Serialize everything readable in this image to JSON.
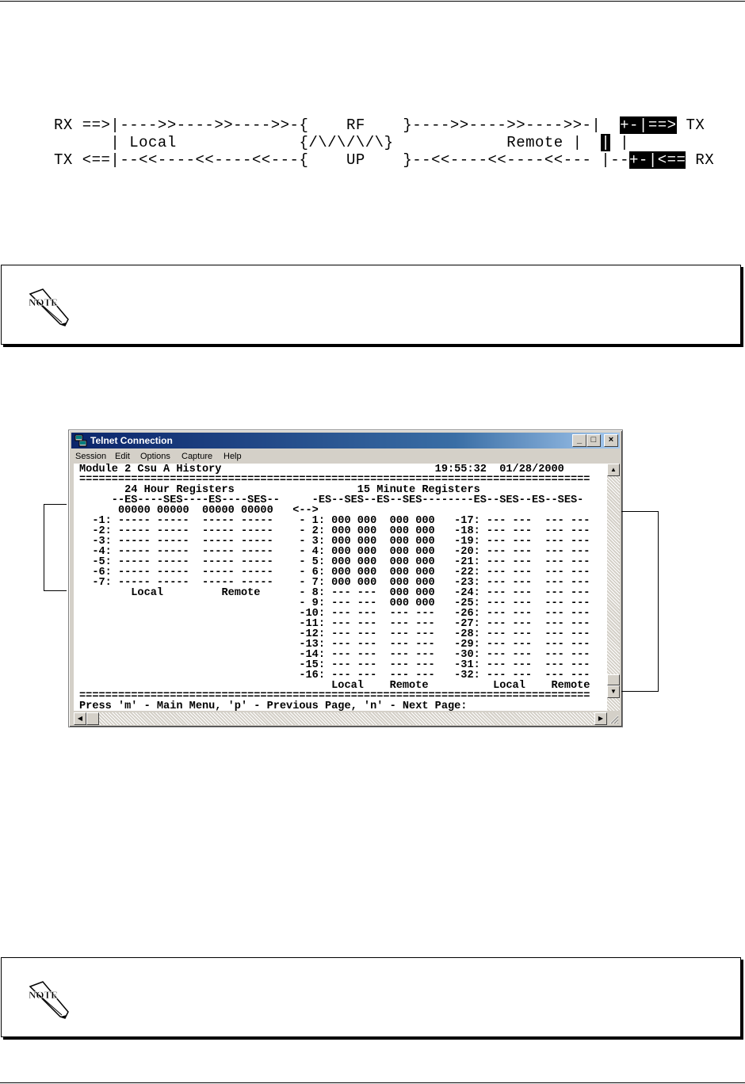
{
  "diagram": {
    "line1_prefix": "RX ==>|---->>---->>---->>-{    RF    }---->>---->>---->>-|  ",
    "line1_box": "+-|==>",
    "line1_suffix": " TX",
    "line2_prefix": "      | Local             {/\\/\\/\\/\\}            Remote |  ",
    "line2_box": "|",
    "line2_mid": " |",
    "line3_prefix": "TX <==|--<<----<<----<<---{    UP    }--<<----<<----<<--- |--",
    "line3_box": "+-|<==",
    "line3_suffix": " RX"
  },
  "telnet": {
    "title": "Telnet Connection",
    "min_btn": "_",
    "max_btn": "□",
    "close_btn": "×",
    "menu": [
      "Session",
      "Edit",
      "Options",
      "Capture",
      "Help"
    ],
    "lines": [
      "Module 2 Csu A History                                 19:55:32  01/28/2000",
      "===============================================================================",
      "       24 Hour Registers                   15 Minute Registers",
      "     --ES----SES----ES----SES--     -ES--SES--ES--SES--------ES--SES--ES--SES-",
      "      00000 00000  00000 00000   <-->",
      "  -1: ----- -----  ----- -----    - 1: 000 000  000 000   -17: --- ---  --- ---",
      "  -2: ----- -----  ----- -----    - 2: 000 000  000 000   -18: --- ---  --- ---",
      "  -3: ----- -----  ----- -----    - 3: 000 000  000 000   -19: --- ---  --- ---",
      "  -4: ----- -----  ----- -----    - 4: 000 000  000 000   -20: --- ---  --- ---",
      "  -5: ----- -----  ----- -----    - 5: 000 000  000 000   -21: --- ---  --- ---",
      "  -6: ----- -----  ----- -----    - 6: 000 000  000 000   -22: --- ---  --- ---",
      "  -7: ----- -----  ----- -----    - 7: 000 000  000 000   -23: --- ---  --- ---",
      "        Local         Remote      - 8: --- ---  000 000   -24: --- ---  --- ---",
      "                                  - 9: --- ---  000 000   -25: --- ---  --- ---",
      "                                  -10: --- ---  --- ---   -26: --- ---  --- ---",
      "                                  -11: --- ---  --- ---   -27: --- ---  --- ---",
      "                                  -12: --- ---  --- ---   -28: --- ---  --- ---",
      "                                  -13: --- ---  --- ---   -29: --- ---  --- ---",
      "                                  -14: --- ---  --- ---   -30: --- ---  --- ---",
      "                                  -15: --- ---  --- ---   -31: --- ---  --- ---",
      "                                  -16: --- ---  --- ---   -32: --- ---  --- ---",
      "                                       Local    Remote          Local    Remote",
      "===============================================================================",
      "Press 'm' - Main Menu, 'p' - Previous Page, 'n' - Next Page:"
    ]
  },
  "notes": [
    {
      "icon": "NOTE"
    },
    {
      "icon": "NOTE"
    }
  ]
}
